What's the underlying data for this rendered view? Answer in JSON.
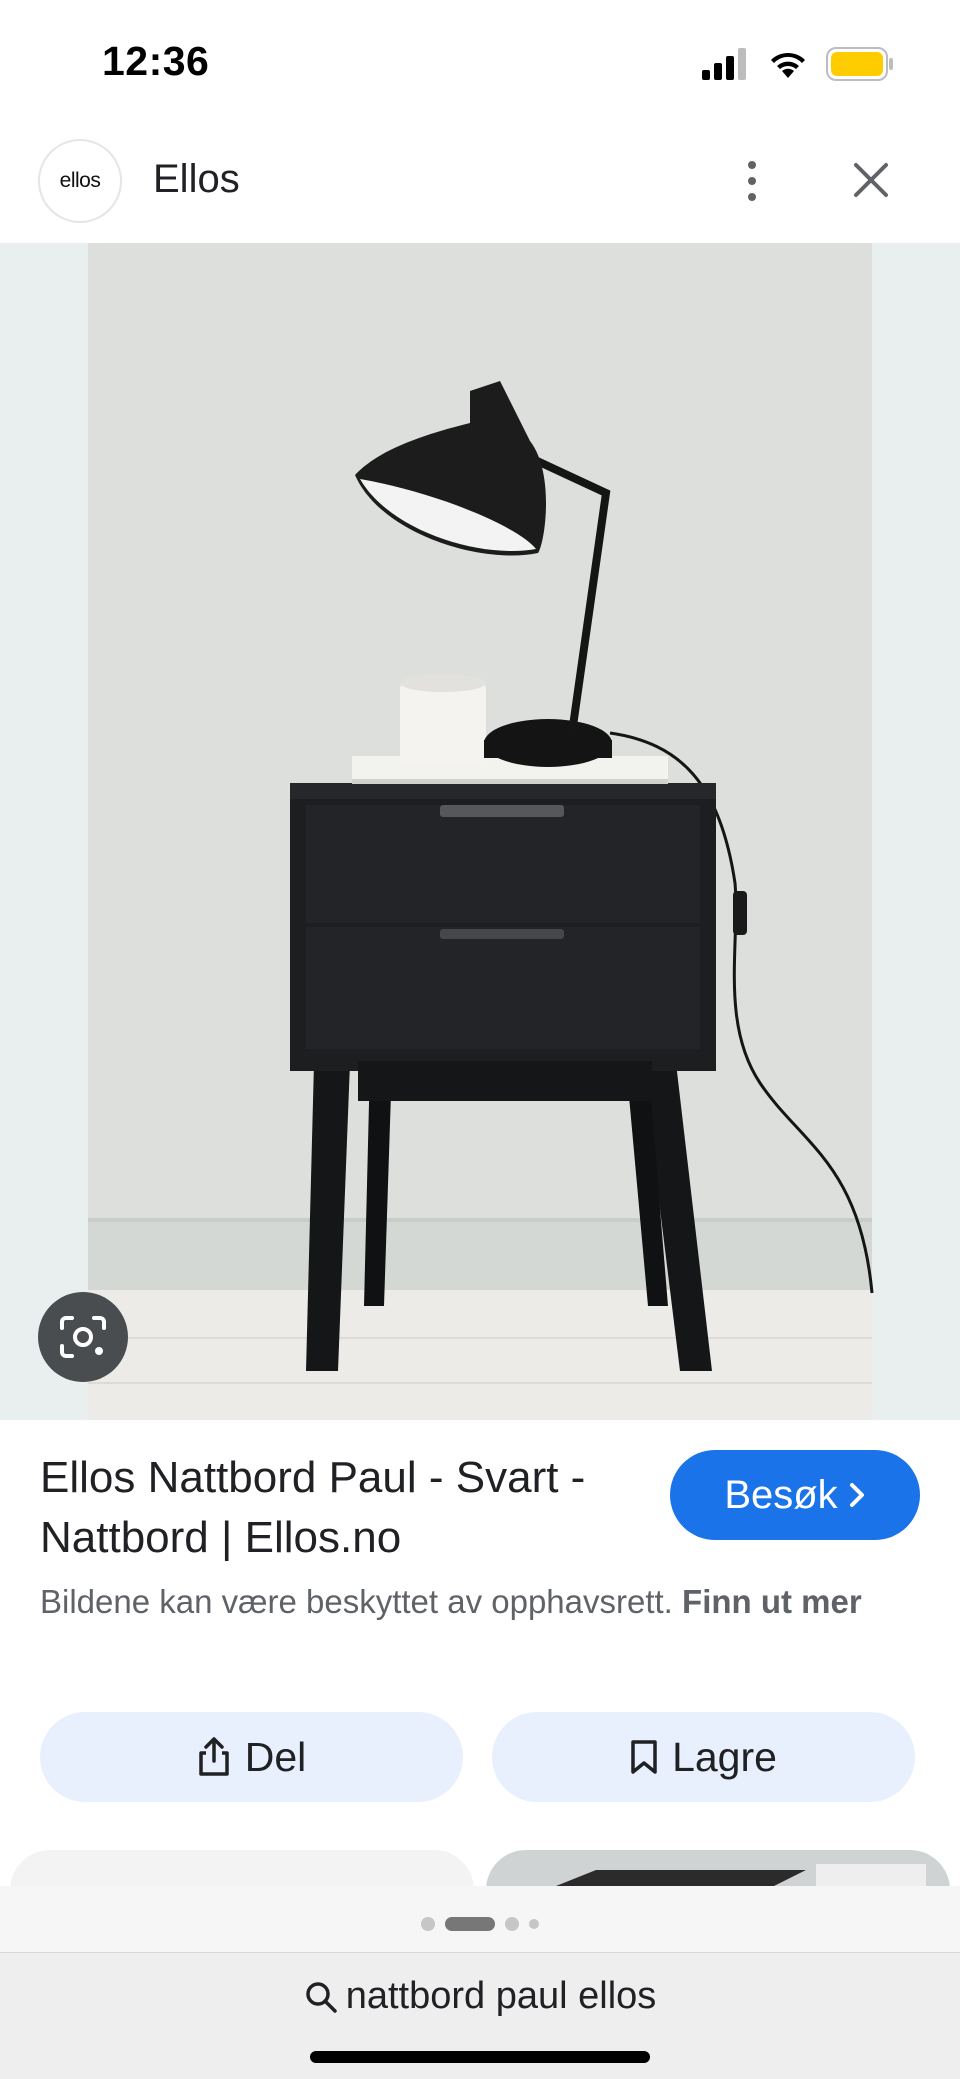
{
  "status_bar": {
    "time": "12:36",
    "battery_color": "#ffcc00"
  },
  "header": {
    "logo_text": "ellos",
    "site_name": "Ellos",
    "menu_icon": "more-vert-icon",
    "close_icon": "close-icon"
  },
  "image": {
    "alt": "Ellos Nattbord Paul - Svart",
    "lens_icon": "google-lens-icon"
  },
  "result": {
    "title": "Ellos Nattbord Paul - Svart - Nattbord | Ellos.no",
    "visit_label": "Besøk",
    "notice_text": "Bildene kan være beskyttet av opphavsrett.",
    "notice_link": "Finn ut mer"
  },
  "actions": {
    "share_label": "Del",
    "save_label": "Lagre"
  },
  "pager": {
    "pages": 4,
    "current": 2
  },
  "search": {
    "query": "nattbord paul ellos"
  },
  "colors": {
    "accent": "#1a73e8",
    "chip_bg": "#e8f0fe"
  }
}
